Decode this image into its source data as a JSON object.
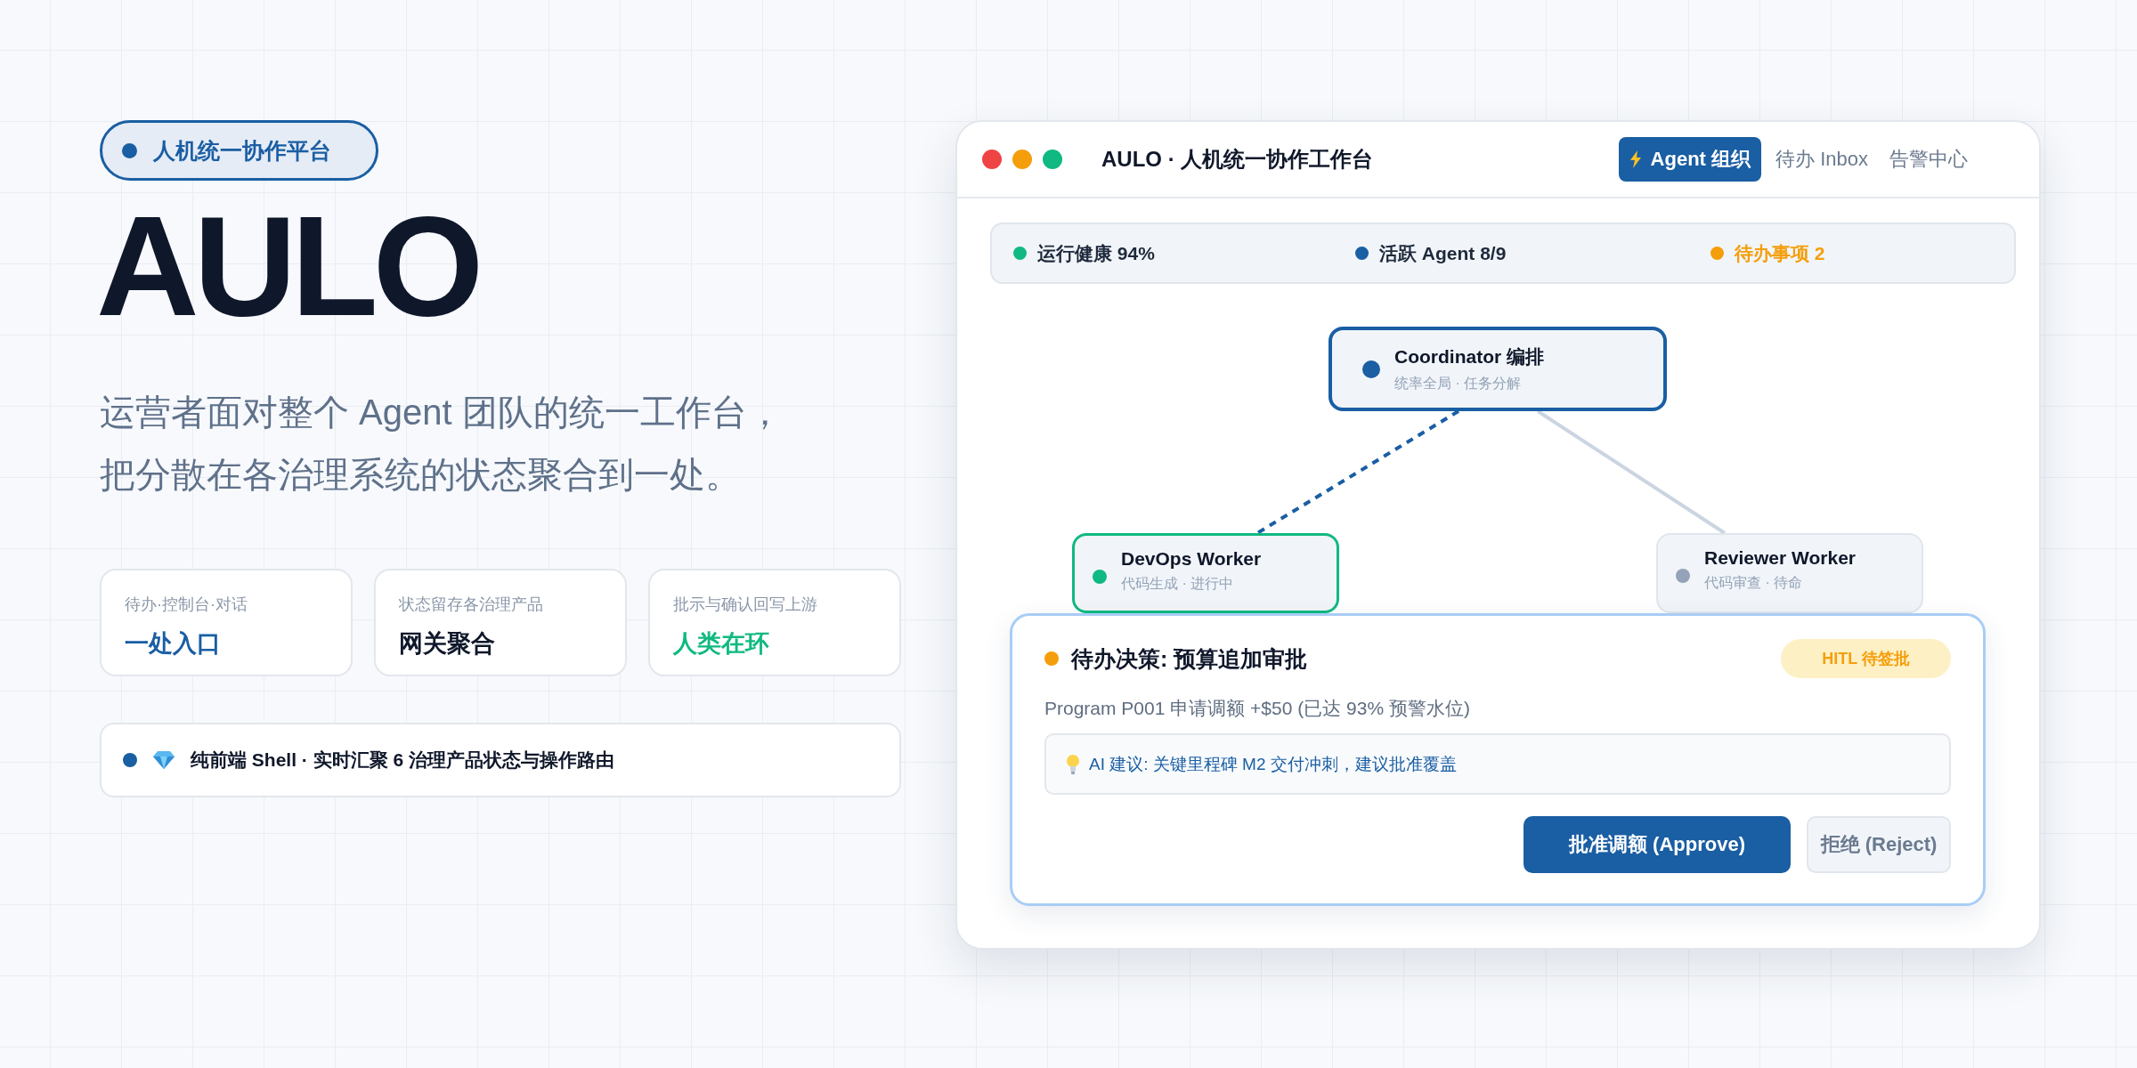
{
  "badge": {
    "label": "人机统一协作平台",
    "color": "#1a5ea3"
  },
  "hero": {
    "title": "AULO",
    "subtitle_lines": [
      "运营者面对整个 Agent 团队的统一工作台，",
      "把分散在各治理系统的状态聚合到一处。"
    ]
  },
  "features": [
    {
      "caption": "待办·控制台·对话",
      "value": "一处入口",
      "color": "#1a5ea3"
    },
    {
      "caption": "状态留存各治理产品",
      "value": "网关聚合",
      "color": "#0f172a"
    },
    {
      "caption": "批示与确认回写上游",
      "value": "人类在环",
      "color": "#10b981"
    }
  ],
  "footer_note": {
    "text": "纯前端 Shell · 实时汇聚 6 治理产品状态与操作路由",
    "color": "#1a5ea3"
  },
  "window": {
    "title": "AULO · 人机统一协作工作台",
    "tabs": [
      {
        "label": "Agent 组织",
        "selected": true
      },
      {
        "label": "待办 Inbox",
        "selected": false
      },
      {
        "label": "告警中心",
        "selected": false
      }
    ]
  },
  "stats": [
    {
      "label": "运行健康 94%",
      "color": "#10b981",
      "kind": "normal"
    },
    {
      "label": "活跃 Agent 8/9",
      "color": "#1a5ea3",
      "kind": "normal"
    },
    {
      "label": "待办事项 2",
      "color": "#f59e0b",
      "kind": "pending"
    }
  ],
  "agents": [
    {
      "name": "Coordinator 编排",
      "detail": "统率全局 · 任务分解",
      "color": "#1a5ea3",
      "kind": "coordinator"
    },
    {
      "name": "DevOps Worker",
      "detail": "代码生成 · 进行中",
      "color": "#10b981",
      "kind": "active"
    },
    {
      "name": "Reviewer Worker",
      "detail": "代码审查 · 待命",
      "color": "#94a3b8",
      "kind": "idle"
    }
  ],
  "decision": {
    "title": "待办决策: 预算追加审批",
    "color": "#f59e0b",
    "status": "HITL 待签批",
    "description": "Program P001 申请调额 +$50 (已达 93% 预警水位)",
    "suggestion": "AI 建议: 关键里程碑 M2 交付冲刺，建议批准覆盖",
    "actions": [
      {
        "label": "批准调额 (Approve)",
        "kind": "primary"
      },
      {
        "label": "拒绝 (Reject)",
        "kind": "secondary"
      }
    ]
  }
}
